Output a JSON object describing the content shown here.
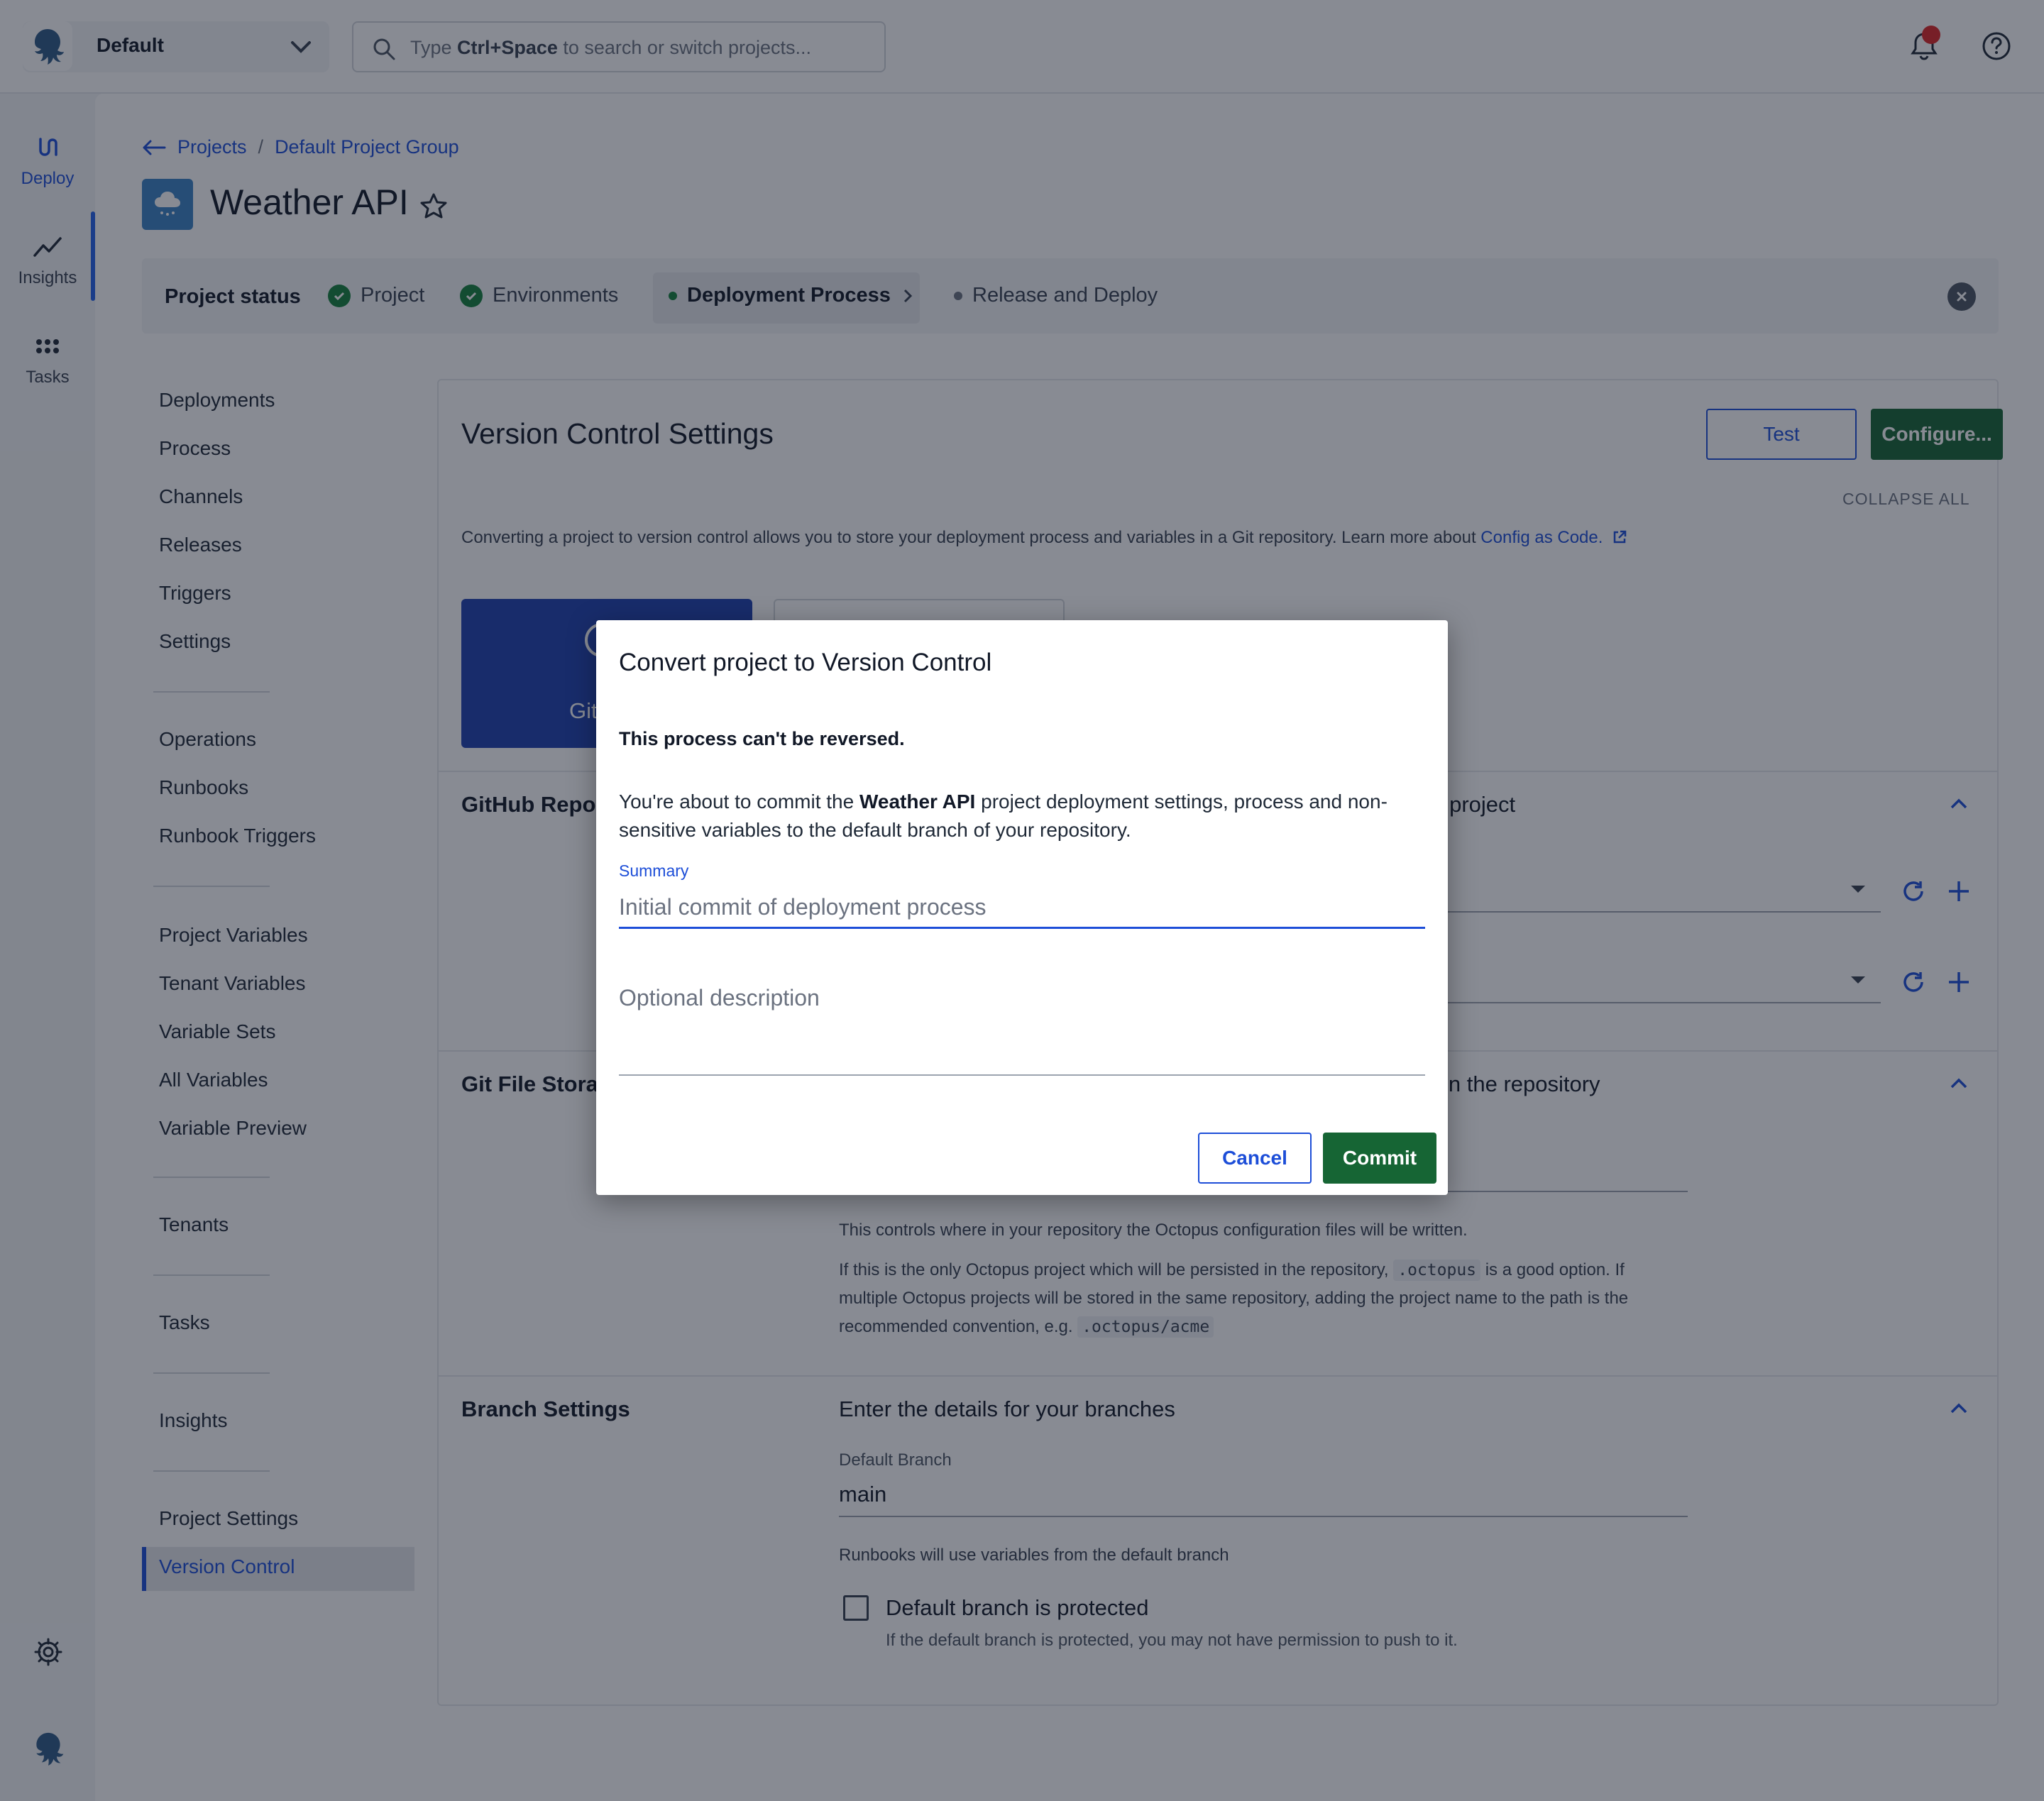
{
  "topbar": {
    "space_name": "Default",
    "search_prefix": "Type ",
    "search_shortcut": "Ctrl+Space",
    "search_suffix": " to search or switch projects..."
  },
  "rail": {
    "items": [
      {
        "label": "Deploy",
        "icon": "deploy-icon"
      },
      {
        "label": "Insights",
        "icon": "insights-icon"
      },
      {
        "label": "Tasks",
        "icon": "tasks-icon"
      }
    ]
  },
  "breadcrumb": {
    "projects": "Projects",
    "separator": "/",
    "group": "Default Project Group"
  },
  "project": {
    "title": "Weather API"
  },
  "status_bar": {
    "title": "Project status",
    "steps": [
      {
        "label": "Project",
        "state": "done"
      },
      {
        "label": "Environments",
        "state": "done"
      },
      {
        "label": "Deployment Process",
        "state": "current"
      },
      {
        "label": "Release and Deploy",
        "state": "pending"
      }
    ]
  },
  "subnav": {
    "groups": [
      [
        "Deployments",
        "Process",
        "Channels",
        "Releases",
        "Triggers",
        "Settings"
      ],
      [
        "Operations",
        "Runbooks",
        "Runbook Triggers"
      ],
      [
        "Project Variables",
        "Tenant Variables",
        "Variable Sets",
        "All Variables",
        "Variable Preview"
      ],
      [
        "Tenants"
      ],
      [
        "Tasks"
      ],
      [
        "Insights"
      ],
      [
        "Project Settings",
        "Version Control"
      ]
    ],
    "active": "Version Control"
  },
  "card": {
    "title": "Version Control Settings",
    "test_label": "Test",
    "configure_label": "Configure...",
    "collapse_all": "COLLAPSE ALL",
    "intro_text": "Converting a project to version control allows you to store your deployment process and variables in a Git repository. Learn more about ",
    "intro_link": "Config as Code.",
    "git_tile_label": "Git",
    "github_section_title": "GitHub Repos",
    "github_section_desc": "s project",
    "storage_section_title": "Git File Stora",
    "storage_section_desc": "in the repository",
    "storage_help_1": "This controls where in your repository the Octopus configuration files will be written.",
    "storage_help_2a": "If this is the only Octopus project which will be persisted in the repository, ",
    "storage_help_code1": ".octopus",
    "storage_help_2b": " is a good option. If",
    "storage_help_3": "multiple Octopus projects will be stored in the same repository, adding the project name to the path is the",
    "storage_help_4a": "recommended convention, e.g. ",
    "storage_help_code2": ".octopus/acme",
    "branch_section_title": "Branch Settings",
    "branch_section_desc": "Enter the details for your branches",
    "default_branch_label": "Default Branch",
    "default_branch_value": "main",
    "runbooks_note": "Runbooks will use variables from the default branch",
    "protected_label": "Default branch is protected",
    "protected_checked": false,
    "protected_help": "If the default branch is protected, you may not have permission to push to it."
  },
  "dialog": {
    "title": "Convert project to Version Control",
    "warning": "This process can't be reversed.",
    "para_prefix": "You're about to commit the ",
    "para_project": "Weather API",
    "para_suffix": " project deployment settings, process and non-sensitive variables to the default branch of your repository.",
    "summary_label": "Summary",
    "summary_placeholder": "Initial commit of deployment process",
    "description_placeholder": "Optional description",
    "cancel_label": "Cancel",
    "commit_label": "Commit"
  },
  "colors": {
    "primary_blue": "#1d4ed8",
    "success_green": "#166534",
    "overlay": "rgba(17,24,39,0.5)"
  }
}
